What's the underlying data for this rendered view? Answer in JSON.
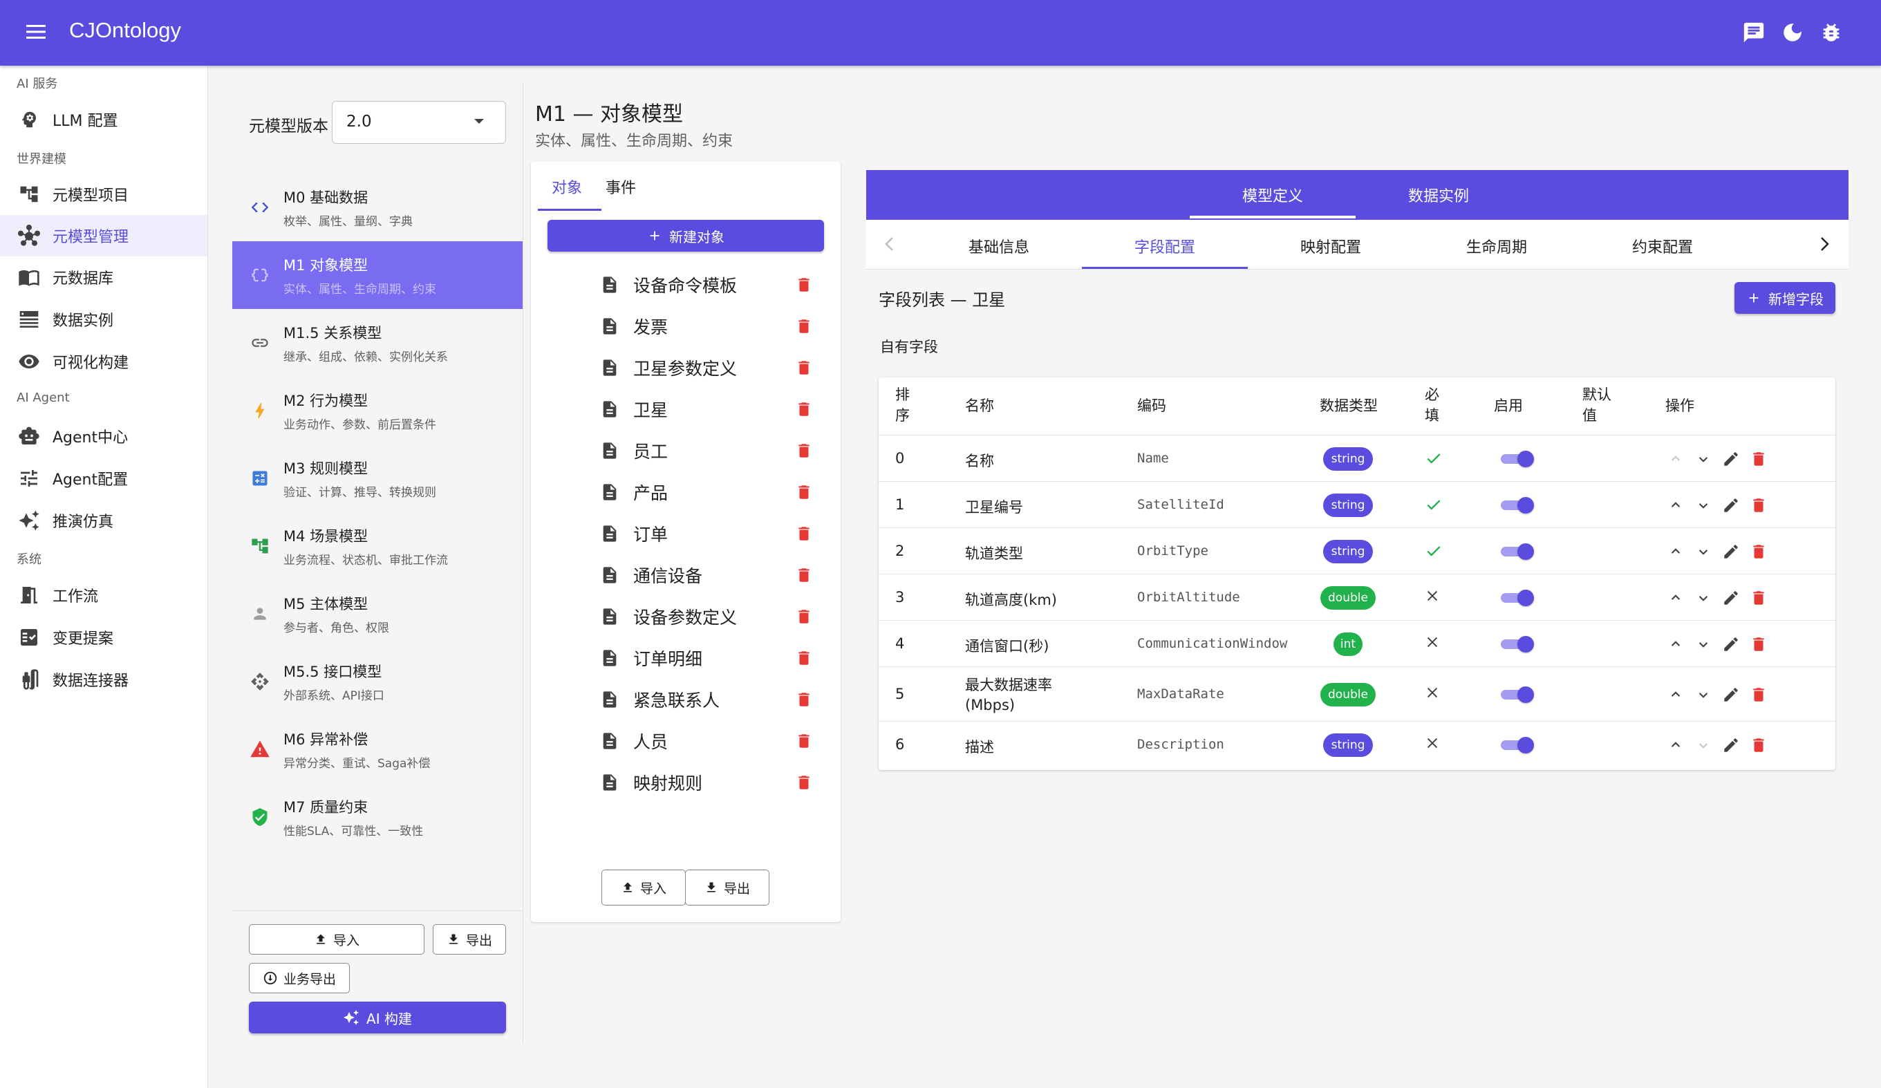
{
  "app": {
    "title": "CJOntology"
  },
  "nav": {
    "sections": [
      {
        "label": "AI 服务",
        "items": [
          {
            "label": "LLM 配置",
            "icon": "brain-icon"
          }
        ]
      },
      {
        "label": "世界建模",
        "items": [
          {
            "label": "元模型项目",
            "icon": "project-icon"
          },
          {
            "label": "元模型管理",
            "icon": "hub-icon",
            "active": true
          },
          {
            "label": "元数据库",
            "icon": "book-icon"
          },
          {
            "label": "数据实例",
            "icon": "list-icon"
          },
          {
            "label": "可视化构建",
            "icon": "eye-icon"
          }
        ]
      },
      {
        "label": "AI Agent",
        "items": [
          {
            "label": "Agent中心",
            "icon": "robot-icon"
          },
          {
            "label": "Agent配置",
            "icon": "tune-icon"
          },
          {
            "label": "推演仿真",
            "icon": "sparkle-icon"
          }
        ]
      },
      {
        "label": "系统",
        "items": [
          {
            "label": "工作流",
            "icon": "workflow-icon"
          },
          {
            "label": "变更提案",
            "icon": "proposal-icon"
          },
          {
            "label": "数据连接器",
            "icon": "connector-icon"
          }
        ]
      }
    ]
  },
  "meta": {
    "version_label": "元模型版本",
    "version_value": "2.0"
  },
  "models": [
    {
      "title": "M0 基础数据",
      "sub": "枚举、属性、量纲、字典",
      "icon": "code-icon"
    },
    {
      "title": "M1 对象模型",
      "sub": "实体、属性、生命周期、约束",
      "icon": "braces-icon",
      "active": true
    },
    {
      "title": "M1.5 关系模型",
      "sub": "继承、组成、依赖、实例化关系",
      "icon": "link-icon"
    },
    {
      "title": "M2 行为模型",
      "sub": "业务动作、参数、前后置条件",
      "icon": "bolt-icon"
    },
    {
      "title": "M3 规则模型",
      "sub": "验证、计算、推导、转换规则",
      "icon": "calculator-icon"
    },
    {
      "title": "M4 场景模型",
      "sub": "业务流程、状态机、审批工作流",
      "icon": "scene-icon"
    },
    {
      "title": "M5 主体模型",
      "sub": "参与者、角色、权限",
      "icon": "person-icon"
    },
    {
      "title": "M5.5 接口模型",
      "sub": "外部系统、API接口",
      "icon": "api-icon"
    },
    {
      "title": "M6 异常补偿",
      "sub": "异常分类、重试、Saga补偿",
      "icon": "warning-icon"
    },
    {
      "title": "M7 质量约束",
      "sub": "性能SLA、可靠性、一致性",
      "icon": "shield-icon"
    }
  ],
  "left_actions": {
    "import": "导入",
    "export": "导出",
    "biz_export": "业务导出",
    "ai_build": "AI 构建"
  },
  "header": {
    "title": "M1 — 对象模型",
    "subtitle": "实体、属性、生命周期、约束"
  },
  "obj_panel": {
    "tabs": [
      "对象",
      "事件"
    ],
    "new_button": "新建对象",
    "items": [
      "设备命令模板",
      "发票",
      "卫星参数定义",
      "卫星",
      "员工",
      "产品",
      "订单",
      "通信设备",
      "设备参数定义",
      "订单明细",
      "紧急联系人",
      "人员",
      "映射规则"
    ],
    "import": "导入",
    "export": "导出"
  },
  "detail": {
    "top_tabs": [
      "模型定义",
      "数据实例"
    ],
    "sub_tabs": [
      "基础信息",
      "字段配置",
      "映射配置",
      "生命周期",
      "约束配置"
    ],
    "field_list_title": "字段列表 — 卫星",
    "add_field": "新增字段",
    "own_fields": "自有字段",
    "columns": {
      "order_1": "排",
      "order_2": "序",
      "name": "名称",
      "code": "编码",
      "type": "数据类型",
      "req_1": "必",
      "req_2": "填",
      "enabled": "启用",
      "default_1": "默认",
      "default_2": "值",
      "ops": "操作"
    },
    "rows": [
      {
        "order": "0",
        "name": "名称",
        "code": "Name",
        "type": "string",
        "required": true,
        "enabled": true
      },
      {
        "order": "1",
        "name": "卫星编号",
        "code": "SatelliteId",
        "type": "string",
        "required": true,
        "enabled": true
      },
      {
        "order": "2",
        "name": "轨道类型",
        "code": "OrbitType",
        "type": "string",
        "required": true,
        "enabled": true
      },
      {
        "order": "3",
        "name": "轨道高度(km)",
        "code": "OrbitAltitude",
        "type": "double",
        "required": false,
        "enabled": true
      },
      {
        "order": "4",
        "name": "通信窗口(秒)",
        "code": "CommunicationWindow",
        "type": "int",
        "required": false,
        "enabled": true
      },
      {
        "order": "5",
        "name_1": "最大数据速率",
        "name_2": "(Mbps)",
        "code": "MaxDataRate",
        "type": "double",
        "required": false,
        "enabled": true
      },
      {
        "order": "6",
        "name": "描述",
        "code": "Description",
        "type": "string",
        "required": false,
        "enabled": true
      }
    ]
  },
  "colors": {
    "primary": "#5b4ce0",
    "success": "#22b24c",
    "danger": "#e53935"
  }
}
